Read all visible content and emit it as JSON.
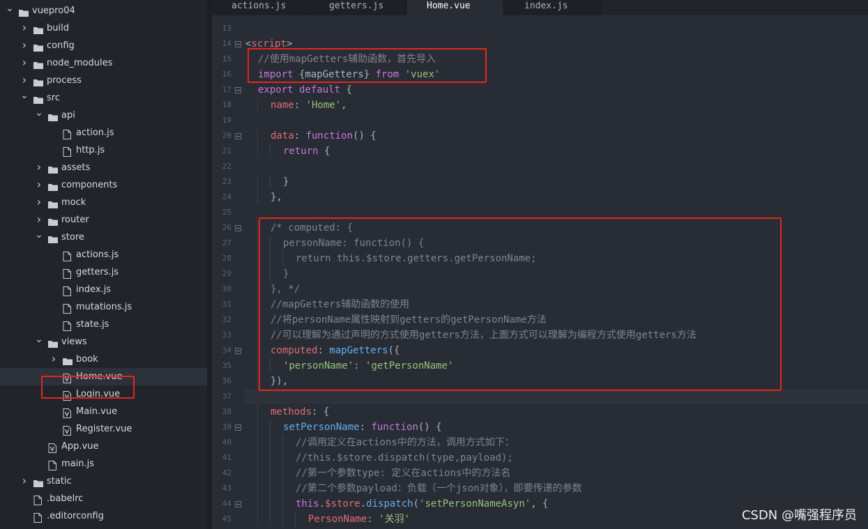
{
  "tree": [
    {
      "label": "vuepro04",
      "kind": "folder",
      "depth": 0,
      "expanded": true
    },
    {
      "label": "build",
      "kind": "folder",
      "depth": 1,
      "expanded": false
    },
    {
      "label": "config",
      "kind": "folder",
      "depth": 1,
      "expanded": false
    },
    {
      "label": "node_modules",
      "kind": "folder",
      "depth": 1,
      "expanded": false
    },
    {
      "label": "process",
      "kind": "folder",
      "depth": 1,
      "expanded": false
    },
    {
      "label": "src",
      "kind": "folder",
      "depth": 1,
      "expanded": true
    },
    {
      "label": "api",
      "kind": "folder",
      "depth": 2,
      "expanded": true
    },
    {
      "label": "action.js",
      "kind": "file",
      "depth": 3
    },
    {
      "label": "http.js",
      "kind": "file",
      "depth": 3
    },
    {
      "label": "assets",
      "kind": "folder",
      "depth": 2,
      "expanded": false
    },
    {
      "label": "components",
      "kind": "folder",
      "depth": 2,
      "expanded": false
    },
    {
      "label": "mock",
      "kind": "folder",
      "depth": 2,
      "expanded": false
    },
    {
      "label": "router",
      "kind": "folder",
      "depth": 2,
      "expanded": false
    },
    {
      "label": "store",
      "kind": "folder",
      "depth": 2,
      "expanded": true
    },
    {
      "label": "actions.js",
      "kind": "file",
      "depth": 3
    },
    {
      "label": "getters.js",
      "kind": "file",
      "depth": 3
    },
    {
      "label": "index.js",
      "kind": "file",
      "depth": 3
    },
    {
      "label": "mutations.js",
      "kind": "file",
      "depth": 3
    },
    {
      "label": "state.js",
      "kind": "file",
      "depth": 3
    },
    {
      "label": "views",
      "kind": "folder",
      "depth": 2,
      "expanded": true
    },
    {
      "label": "book",
      "kind": "folder",
      "depth": 3,
      "expanded": false
    },
    {
      "label": "Home.vue",
      "kind": "vue",
      "depth": 3,
      "selected": true
    },
    {
      "label": "Login.vue",
      "kind": "vue",
      "depth": 3
    },
    {
      "label": "Main.vue",
      "kind": "vue",
      "depth": 3
    },
    {
      "label": "Register.vue",
      "kind": "vue",
      "depth": 3
    },
    {
      "label": "App.vue",
      "kind": "vue",
      "depth": 2
    },
    {
      "label": "main.js",
      "kind": "file",
      "depth": 2
    },
    {
      "label": "static",
      "kind": "folder",
      "depth": 1,
      "expanded": false
    },
    {
      "label": ".babelrc",
      "kind": "file",
      "depth": 1
    },
    {
      "label": ".editorconfig",
      "kind": "file",
      "depth": 1
    }
  ],
  "tabs": [
    {
      "label": "actions.js",
      "active": false
    },
    {
      "label": "getters.js",
      "active": false
    },
    {
      "label": "Home.vue",
      "active": true
    },
    {
      "label": "index.js",
      "active": false
    }
  ],
  "code": [
    {
      "ln": "13",
      "indent": 0,
      "fold": false,
      "t": []
    },
    {
      "ln": "14",
      "indent": 0,
      "fold": true,
      "t": [
        [
          "pun",
          "<"
        ],
        [
          "tag",
          "script"
        ],
        [
          "pun",
          ">"
        ]
      ]
    },
    {
      "ln": "15",
      "indent": 1,
      "fold": false,
      "t": [
        [
          "cm",
          "//使用mapGetters辅助函数，首先导入"
        ]
      ]
    },
    {
      "ln": "16",
      "indent": 1,
      "fold": false,
      "t": [
        [
          "kw",
          "import"
        ],
        [
          "pun",
          " {mapGetters} "
        ],
        [
          "kw",
          "from"
        ],
        [
          "pun",
          " "
        ],
        [
          "str",
          "'vuex'"
        ]
      ]
    },
    {
      "ln": "17",
      "indent": 1,
      "fold": true,
      "t": [
        [
          "kw",
          "export"
        ],
        [
          "pun",
          " "
        ],
        [
          "kw",
          "default"
        ],
        [
          "pun",
          " {"
        ]
      ]
    },
    {
      "ln": "18",
      "indent": 2,
      "fold": false,
      "t": [
        [
          "prop",
          "name"
        ],
        [
          "pun",
          ": "
        ],
        [
          "str",
          "'Home'"
        ],
        [
          "pun",
          ","
        ]
      ]
    },
    {
      "ln": "19",
      "indent": 0,
      "fold": false,
      "t": []
    },
    {
      "ln": "20",
      "indent": 2,
      "fold": true,
      "t": [
        [
          "prop",
          "data"
        ],
        [
          "pun",
          ": "
        ],
        [
          "kw",
          "function"
        ],
        [
          "pun",
          "() {"
        ]
      ]
    },
    {
      "ln": "21",
      "indent": 3,
      "fold": false,
      "t": [
        [
          "kw",
          "return"
        ],
        [
          "pun",
          " {"
        ]
      ]
    },
    {
      "ln": "22",
      "indent": 0,
      "fold": false,
      "t": []
    },
    {
      "ln": "23",
      "indent": 3,
      "fold": false,
      "t": [
        [
          "pun",
          "}"
        ]
      ]
    },
    {
      "ln": "24",
      "indent": 2,
      "fold": false,
      "t": [
        [
          "pun",
          "},"
        ]
      ]
    },
    {
      "ln": "25",
      "indent": 0,
      "fold": false,
      "t": []
    },
    {
      "ln": "26",
      "indent": 2,
      "fold": true,
      "t": [
        [
          "cm",
          "/* computed: {"
        ]
      ]
    },
    {
      "ln": "27",
      "indent": 3,
      "fold": false,
      "t": [
        [
          "cm",
          "personName: function() {"
        ]
      ]
    },
    {
      "ln": "28",
      "indent": 4,
      "fold": false,
      "t": [
        [
          "cm",
          "return this.$store.getters.getPersonName;"
        ]
      ]
    },
    {
      "ln": "29",
      "indent": 3,
      "fold": false,
      "t": [
        [
          "cm",
          "}"
        ]
      ]
    },
    {
      "ln": "30",
      "indent": 2,
      "fold": false,
      "t": [
        [
          "cm",
          "}, */"
        ]
      ]
    },
    {
      "ln": "31",
      "indent": 2,
      "fold": false,
      "t": [
        [
          "cm",
          "//mapGetters辅助函数的使用"
        ]
      ]
    },
    {
      "ln": "32",
      "indent": 2,
      "fold": false,
      "t": [
        [
          "cm",
          "//将personName属性映射到getters的getPersonName方法"
        ]
      ]
    },
    {
      "ln": "33",
      "indent": 2,
      "fold": false,
      "t": [
        [
          "cm",
          "//可以理解为通过声明的方式使用getters方法，上面方式可以理解为编程方式使用getters方法"
        ]
      ]
    },
    {
      "ln": "34",
      "indent": 2,
      "fold": true,
      "t": [
        [
          "prop",
          "computed"
        ],
        [
          "pun",
          ": "
        ],
        [
          "fn",
          "mapGetters"
        ],
        [
          "pun",
          "({"
        ]
      ]
    },
    {
      "ln": "35",
      "indent": 3,
      "fold": false,
      "t": [
        [
          "str",
          "'personName'"
        ],
        [
          "pun",
          ": "
        ],
        [
          "str",
          "'getPersonName'"
        ]
      ]
    },
    {
      "ln": "36",
      "indent": 2,
      "fold": false,
      "t": [
        [
          "pun",
          "}),"
        ]
      ]
    },
    {
      "ln": "37",
      "indent": 0,
      "fold": false,
      "t": [],
      "current": true
    },
    {
      "ln": "38",
      "indent": 2,
      "fold": false,
      "t": [
        [
          "prop",
          "methods"
        ],
        [
          "pun",
          ": {"
        ]
      ]
    },
    {
      "ln": "39",
      "indent": 3,
      "fold": true,
      "t": [
        [
          "fn",
          "setPersonName"
        ],
        [
          "pun",
          ": "
        ],
        [
          "kw",
          "function"
        ],
        [
          "pun",
          "() {"
        ]
      ]
    },
    {
      "ln": "40",
      "indent": 4,
      "fold": false,
      "t": [
        [
          "cm",
          "//调用定义在actions中的方法，调用方式如下："
        ]
      ]
    },
    {
      "ln": "41",
      "indent": 4,
      "fold": false,
      "t": [
        [
          "cm",
          "//this.$store.dispatch(type,payload);"
        ]
      ]
    },
    {
      "ln": "42",
      "indent": 4,
      "fold": false,
      "t": [
        [
          "cm",
          "//第一个参数type: 定义在actions中的方法名"
        ]
      ]
    },
    {
      "ln": "43",
      "indent": 4,
      "fold": false,
      "t": [
        [
          "cm",
          "//第二个参数payload：负载（一个json对象），即要传递的参数"
        ]
      ]
    },
    {
      "ln": "44",
      "indent": 4,
      "fold": true,
      "t": [
        [
          "kw",
          "this"
        ],
        [
          "pun",
          "."
        ],
        [
          "prop",
          "$store"
        ],
        [
          "pun",
          "."
        ],
        [
          "fn",
          "dispatch"
        ],
        [
          "pun",
          "("
        ],
        [
          "str",
          "'setPersonNameAsyn'"
        ],
        [
          "pun",
          ", {"
        ]
      ]
    },
    {
      "ln": "45",
      "indent": 5,
      "fold": false,
      "t": [
        [
          "prop",
          "PersonName"
        ],
        [
          "pun",
          ": "
        ],
        [
          "str",
          "'关羽'"
        ]
      ]
    }
  ],
  "colors": {
    "keyword": "#c678dd",
    "string": "#98c379",
    "comment": "#7f848e",
    "property": "#e06c75",
    "function": "#61afef",
    "highlight_box": "#e8251d"
  },
  "watermark": "CSDN @嘴强程序员"
}
